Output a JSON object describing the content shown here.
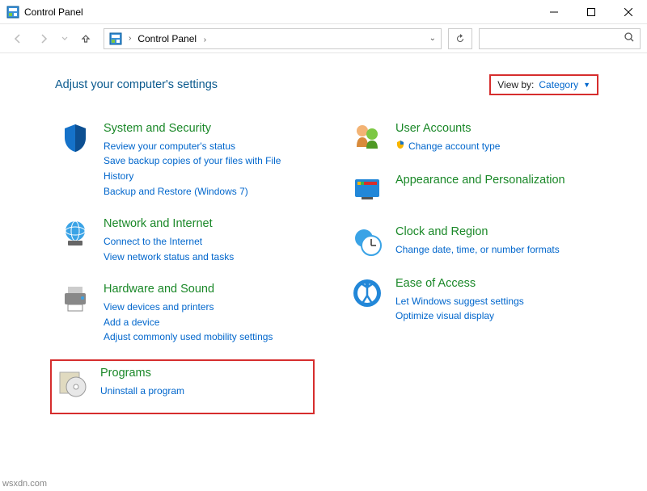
{
  "window": {
    "title": "Control Panel"
  },
  "navigation": {
    "breadcrumb": "Control Panel",
    "sep": "›",
    "search_placeholder": ""
  },
  "header": {
    "heading": "Adjust your computer's settings",
    "viewby_label": "View by:",
    "viewby_value": "Category"
  },
  "left_categories": [
    {
      "title": "System and Security",
      "links": [
        "Review your computer's status",
        "Save backup copies of your files with File History",
        "Backup and Restore (Windows 7)"
      ]
    },
    {
      "title": "Network and Internet",
      "links": [
        "Connect to the Internet",
        "View network status and tasks"
      ]
    },
    {
      "title": "Hardware and Sound",
      "links": [
        "View devices and printers",
        "Add a device",
        "Adjust commonly used mobility settings"
      ]
    },
    {
      "title": "Programs",
      "links": [
        "Uninstall a program"
      ]
    }
  ],
  "right_categories": [
    {
      "title": "User Accounts",
      "links": [
        "Change account type"
      ],
      "shield": [
        true
      ]
    },
    {
      "title": "Appearance and Personalization",
      "links": []
    },
    {
      "title": "Clock and Region",
      "links": [
        "Change date, time, or number formats"
      ]
    },
    {
      "title": "Ease of Access",
      "links": [
        "Let Windows suggest settings",
        "Optimize visual display"
      ]
    }
  ],
  "watermark": "wsxdn.com"
}
